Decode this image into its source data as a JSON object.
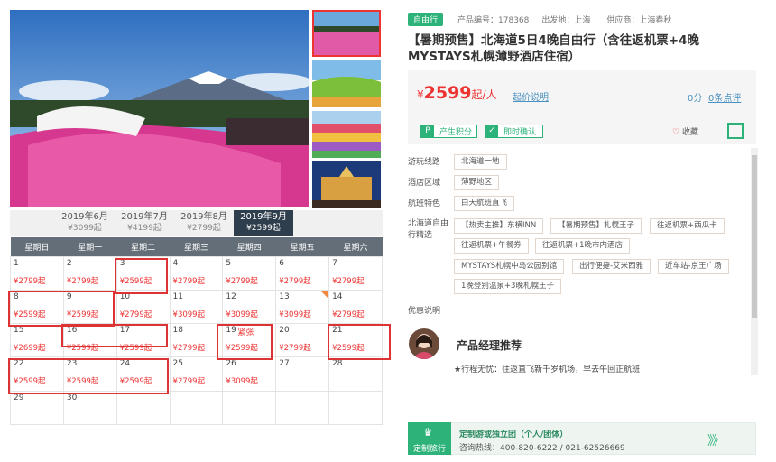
{
  "gallery": {
    "main_alt": "Mt. Fuji with pink moss phlox field",
    "thumbs": [
      "pink flower field",
      "green hills",
      "colorful flower fields",
      "ice sculpture night festival"
    ]
  },
  "months": [
    {
      "label": "2019年6月",
      "price": "¥3099起"
    },
    {
      "label": "2019年7月",
      "price": "¥4199起"
    },
    {
      "label": "2019年8月",
      "price": "¥2799起"
    },
    {
      "label": "2019年9月",
      "price": "¥2599起",
      "active": true
    }
  ],
  "weekdays": [
    "星期日",
    "星期一",
    "星期二",
    "星期三",
    "星期四",
    "星期五",
    "星期六"
  ],
  "calendar": [
    [
      {
        "d": "1",
        "p": "¥2799起"
      },
      {
        "d": "2",
        "p": "¥2799起"
      },
      {
        "d": "3",
        "p": "¥2599起"
      },
      {
        "d": "4",
        "p": "¥2799起"
      },
      {
        "d": "5",
        "p": "¥2799起"
      },
      {
        "d": "6",
        "p": "¥2799起"
      },
      {
        "d": "7",
        "p": "¥2799起"
      }
    ],
    [
      {
        "d": "8",
        "p": "¥2599起"
      },
      {
        "d": "9",
        "p": "¥2599起"
      },
      {
        "d": "10",
        "p": "¥2799起"
      },
      {
        "d": "11",
        "p": "¥3099起"
      },
      {
        "d": "12",
        "p": "¥3099起"
      },
      {
        "d": "13",
        "p": "¥3099起"
      },
      {
        "d": "14",
        "p": "¥2799起"
      }
    ],
    [
      {
        "d": "15",
        "p": "¥2699起"
      },
      {
        "d": "16",
        "p": "¥2599起"
      },
      {
        "d": "17",
        "p": "¥2599起"
      },
      {
        "d": "18",
        "p": "¥2799起"
      },
      {
        "d": "19",
        "t": "紧张",
        "p": "¥2599起"
      },
      {
        "d": "20",
        "p": "¥2799起"
      },
      {
        "d": "21",
        "p": "¥2599起"
      }
    ],
    [
      {
        "d": "22",
        "p": "¥2599起"
      },
      {
        "d": "23",
        "p": "¥2599起"
      },
      {
        "d": "24",
        "p": "¥2599起"
      },
      {
        "d": "25",
        "p": "¥2799起"
      },
      {
        "d": "26",
        "p": "¥3099起"
      },
      {
        "d": "27",
        "p": ""
      },
      {
        "d": "28",
        "p": ""
      }
    ],
    [
      {
        "d": "29",
        "p": ""
      },
      {
        "d": "30",
        "p": ""
      },
      {
        "d": "",
        "p": ""
      },
      {
        "d": "",
        "p": ""
      },
      {
        "d": "",
        "p": ""
      },
      {
        "d": "",
        "p": ""
      },
      {
        "d": "",
        "p": ""
      }
    ]
  ],
  "product": {
    "badge": "自由行",
    "code": "产品编号：178368",
    "departure": "出发地：上海",
    "supplier": "供应商：上海春秋",
    "title": "【暑期预售】北海道5日4晚自由行（含往返机票+4晚MYSTAYS札幌薄野酒店住宿）"
  },
  "price": {
    "symbol": "¥",
    "amount": "2599",
    "suffix": "起/人",
    "explain": "起价说明",
    "score": "0分",
    "reviews": "0条点评"
  },
  "chips": [
    {
      "icon": "P",
      "label": "产生积分"
    },
    {
      "icon": "✓",
      "label": "即时确认"
    }
  ],
  "fav": "收藏",
  "options": {
    "route_label": "游玩线路",
    "route": [
      "北海道一地"
    ],
    "hotel_label": "酒店区域",
    "hotel": [
      "薄野地区"
    ],
    "flight_label": "航班特色",
    "flight": [
      "白天航班直飞"
    ],
    "free_label": "北海道自由行精选",
    "free": [
      "【热卖主推】东横INN",
      "【暑期预售】札幌王子",
      "往返机票+西瓜卡",
      "往返机票+午餐券",
      "往返机票+1晚市内酒店",
      "MYSTAYS札幌中岛公园别馆",
      "出行便捷-艾米西雅",
      "近车站-京王广场",
      "1晚登别温泉+3晚札幌王子"
    ]
  },
  "discount_label": "优惠说明",
  "manager": {
    "title": "产品经理推荐",
    "note": "★行程无忧：往返直飞新千岁机场，早去午回正航班"
  },
  "footer": {
    "badge": "定制旅行",
    "title": "定制游或独立团（个人/团体）",
    "phone": "咨询热线：400-820-6222 / 021-62526669",
    "arrow": "》》"
  },
  "colors": {
    "accent": "#2db27a",
    "price": "#e33333",
    "link": "#4a90c0"
  }
}
